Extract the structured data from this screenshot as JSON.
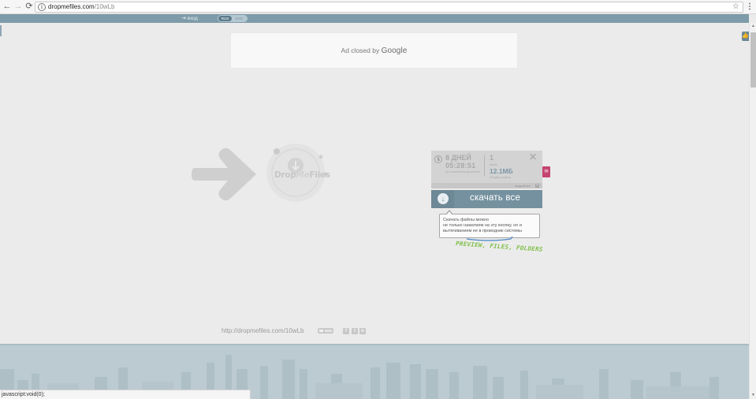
{
  "browser": {
    "back_icon": "←",
    "forward_icon": "→",
    "reload_icon": "⟳",
    "info_icon": "i",
    "url_host": "dropmefiles.com",
    "url_path": "/10wLb",
    "star_icon": "☆",
    "menu_icon": "⋮"
  },
  "topbar": {
    "login_icon": "⇥",
    "login_label": "вход",
    "lang_rus": "rus",
    "lang_eng": "eng",
    "background_color": "#7e9ba9"
  },
  "ad": {
    "text": "Ad closed by",
    "brand": "Google"
  },
  "logo": {
    "part1": "Drop",
    "part2": "Me",
    "part3": "Files"
  },
  "file_info": {
    "days": "8 ДНЕЙ",
    "timer": "05:28:51",
    "timer_caption": "до окончания хранения",
    "file_count": "1",
    "file_label": "файл",
    "total_size": "12.1МБ",
    "size_label": "общий размер",
    "close_icon": "✕",
    "details_link": "подробнее",
    "details_plus": "+",
    "comment_icon": "✉"
  },
  "download": {
    "icon": "↓",
    "label": "скачать все",
    "color": "#75919f"
  },
  "tooltip": {
    "line1": "Скачать файлы можно",
    "line2": "не только нажатием на эту кнопку, но и",
    "line3": "вытягиванием ее в проводник системы",
    "preview_hint": "PREVIEW, FILES, FOLDERS",
    "hint_color": "#7fbf48"
  },
  "share": {
    "url": "http://dropmefiles.com/10wLb",
    "fb": "f",
    "tw": "t",
    "vk": "в"
  },
  "status_bar": {
    "text": "javascript:void(0);"
  },
  "scrollbar": {
    "up_icon": "▲",
    "down_icon": "▼",
    "like_icon": "👍"
  }
}
